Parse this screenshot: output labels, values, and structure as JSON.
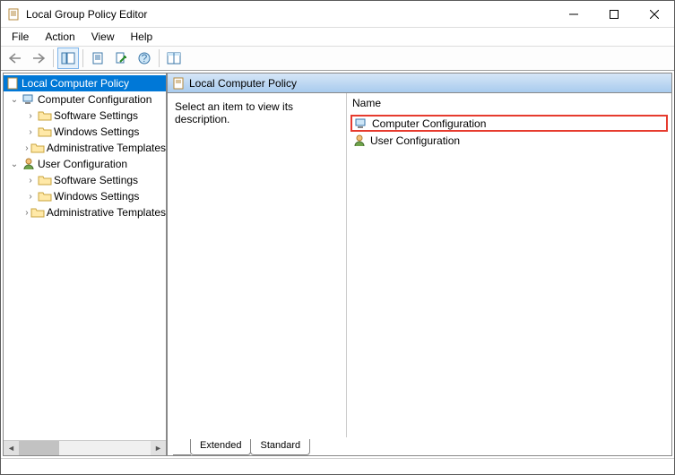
{
  "window": {
    "title": "Local Group Policy Editor"
  },
  "menu": {
    "file": "File",
    "action": "Action",
    "view": "View",
    "help": "Help"
  },
  "tree": {
    "root": "Local Computer Policy",
    "compconf": "Computer Configuration",
    "cc_soft": "Software Settings",
    "cc_win": "Windows Settings",
    "cc_adm": "Administrative Templates",
    "userconf": "User Configuration",
    "uc_soft": "Software Settings",
    "uc_win": "Windows Settings",
    "uc_adm": "Administrative Templates"
  },
  "header": {
    "title": "Local Computer Policy"
  },
  "desc": {
    "text": "Select an item to view its description."
  },
  "list": {
    "col_name": "Name",
    "item0": "Computer Configuration",
    "item1": "User Configuration"
  },
  "tabs": {
    "extended": "Extended",
    "standard": "Standard"
  }
}
